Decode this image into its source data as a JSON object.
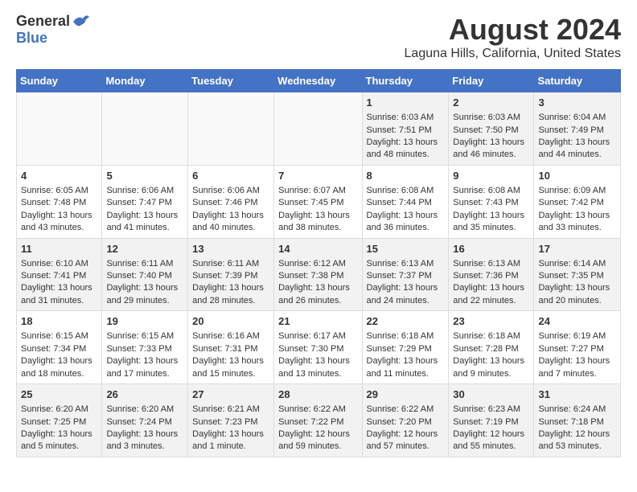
{
  "header": {
    "logo": {
      "general": "General",
      "blue": "Blue"
    },
    "title": "August 2024",
    "subtitle": "Laguna Hills, California, United States"
  },
  "calendar": {
    "days_of_week": [
      "Sunday",
      "Monday",
      "Tuesday",
      "Wednesday",
      "Thursday",
      "Friday",
      "Saturday"
    ],
    "weeks": [
      [
        {
          "day": "",
          "content": ""
        },
        {
          "day": "",
          "content": ""
        },
        {
          "day": "",
          "content": ""
        },
        {
          "day": "",
          "content": ""
        },
        {
          "day": "1",
          "content": "Sunrise: 6:03 AM\nSunset: 7:51 PM\nDaylight: 13 hours and 48 minutes."
        },
        {
          "day": "2",
          "content": "Sunrise: 6:03 AM\nSunset: 7:50 PM\nDaylight: 13 hours and 46 minutes."
        },
        {
          "day": "3",
          "content": "Sunrise: 6:04 AM\nSunset: 7:49 PM\nDaylight: 13 hours and 44 minutes."
        }
      ],
      [
        {
          "day": "4",
          "content": "Sunrise: 6:05 AM\nSunset: 7:48 PM\nDaylight: 13 hours and 43 minutes."
        },
        {
          "day": "5",
          "content": "Sunrise: 6:06 AM\nSunset: 7:47 PM\nDaylight: 13 hours and 41 minutes."
        },
        {
          "day": "6",
          "content": "Sunrise: 6:06 AM\nSunset: 7:46 PM\nDaylight: 13 hours and 40 minutes."
        },
        {
          "day": "7",
          "content": "Sunrise: 6:07 AM\nSunset: 7:45 PM\nDaylight: 13 hours and 38 minutes."
        },
        {
          "day": "8",
          "content": "Sunrise: 6:08 AM\nSunset: 7:44 PM\nDaylight: 13 hours and 36 minutes."
        },
        {
          "day": "9",
          "content": "Sunrise: 6:08 AM\nSunset: 7:43 PM\nDaylight: 13 hours and 35 minutes."
        },
        {
          "day": "10",
          "content": "Sunrise: 6:09 AM\nSunset: 7:42 PM\nDaylight: 13 hours and 33 minutes."
        }
      ],
      [
        {
          "day": "11",
          "content": "Sunrise: 6:10 AM\nSunset: 7:41 PM\nDaylight: 13 hours and 31 minutes."
        },
        {
          "day": "12",
          "content": "Sunrise: 6:11 AM\nSunset: 7:40 PM\nDaylight: 13 hours and 29 minutes."
        },
        {
          "day": "13",
          "content": "Sunrise: 6:11 AM\nSunset: 7:39 PM\nDaylight: 13 hours and 28 minutes."
        },
        {
          "day": "14",
          "content": "Sunrise: 6:12 AM\nSunset: 7:38 PM\nDaylight: 13 hours and 26 minutes."
        },
        {
          "day": "15",
          "content": "Sunrise: 6:13 AM\nSunset: 7:37 PM\nDaylight: 13 hours and 24 minutes."
        },
        {
          "day": "16",
          "content": "Sunrise: 6:13 AM\nSunset: 7:36 PM\nDaylight: 13 hours and 22 minutes."
        },
        {
          "day": "17",
          "content": "Sunrise: 6:14 AM\nSunset: 7:35 PM\nDaylight: 13 hours and 20 minutes."
        }
      ],
      [
        {
          "day": "18",
          "content": "Sunrise: 6:15 AM\nSunset: 7:34 PM\nDaylight: 13 hours and 18 minutes."
        },
        {
          "day": "19",
          "content": "Sunrise: 6:15 AM\nSunset: 7:33 PM\nDaylight: 13 hours and 17 minutes."
        },
        {
          "day": "20",
          "content": "Sunrise: 6:16 AM\nSunset: 7:31 PM\nDaylight: 13 hours and 15 minutes."
        },
        {
          "day": "21",
          "content": "Sunrise: 6:17 AM\nSunset: 7:30 PM\nDaylight: 13 hours and 13 minutes."
        },
        {
          "day": "22",
          "content": "Sunrise: 6:18 AM\nSunset: 7:29 PM\nDaylight: 13 hours and 11 minutes."
        },
        {
          "day": "23",
          "content": "Sunrise: 6:18 AM\nSunset: 7:28 PM\nDaylight: 13 hours and 9 minutes."
        },
        {
          "day": "24",
          "content": "Sunrise: 6:19 AM\nSunset: 7:27 PM\nDaylight: 13 hours and 7 minutes."
        }
      ],
      [
        {
          "day": "25",
          "content": "Sunrise: 6:20 AM\nSunset: 7:25 PM\nDaylight: 13 hours and 5 minutes."
        },
        {
          "day": "26",
          "content": "Sunrise: 6:20 AM\nSunset: 7:24 PM\nDaylight: 13 hours and 3 minutes."
        },
        {
          "day": "27",
          "content": "Sunrise: 6:21 AM\nSunset: 7:23 PM\nDaylight: 13 hours and 1 minute."
        },
        {
          "day": "28",
          "content": "Sunrise: 6:22 AM\nSunset: 7:22 PM\nDaylight: 12 hours and 59 minutes."
        },
        {
          "day": "29",
          "content": "Sunrise: 6:22 AM\nSunset: 7:20 PM\nDaylight: 12 hours and 57 minutes."
        },
        {
          "day": "30",
          "content": "Sunrise: 6:23 AM\nSunset: 7:19 PM\nDaylight: 12 hours and 55 minutes."
        },
        {
          "day": "31",
          "content": "Sunrise: 6:24 AM\nSunset: 7:18 PM\nDaylight: 12 hours and 53 minutes."
        }
      ]
    ]
  }
}
